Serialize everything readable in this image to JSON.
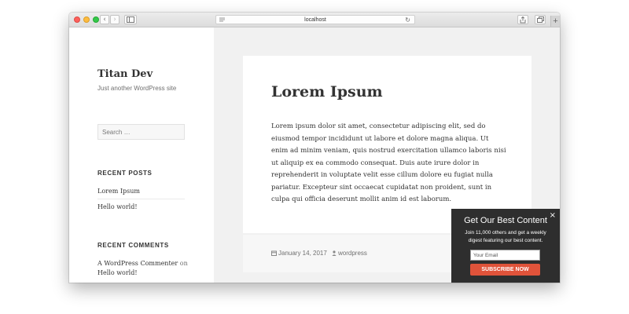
{
  "browser": {
    "url": "localhost",
    "reload_glyph": "↻",
    "back_glyph": "‹",
    "forward_glyph": "›",
    "new_tab_glyph": "+"
  },
  "site": {
    "title": "Titan Dev",
    "description": "Just another WordPress site"
  },
  "sidebar": {
    "search_placeholder": "Search …",
    "recent_posts": {
      "heading": "RECENT POSTS",
      "items": [
        "Lorem Ipsum",
        "Hello world!"
      ]
    },
    "recent_comments": {
      "heading": "RECENT COMMENTS",
      "author": "A WordPress Commenter",
      "on": "on",
      "post": "Hello world!"
    }
  },
  "article": {
    "title": "Lorem Ipsum",
    "body": "Lorem ipsum dolor sit amet, consectetur adipiscing elit, sed do eiusmod tempor incididunt ut labore et dolore magna aliqua. Ut enim ad minim veniam, quis nostrud exercitation ullamco laboris nisi ut aliquip ex ea commodo consequat. Duis aute irure dolor in reprehenderit in voluptate velit esse cillum dolore eu fugiat nulla pariatur. Excepteur sint occaecat cupidatat non proident, sunt in culpa qui officia deserunt mollit anim id est laborum.",
    "date": "January 14, 2017",
    "author": "wordpress"
  },
  "popup": {
    "close_glyph": "×",
    "title": "Get Our Best Content",
    "text": "Join 11,000 others and get a weekly digest featuring our best content.",
    "email_placeholder": "Your Email",
    "button_label": "SUBSCRIBE NOW"
  }
}
